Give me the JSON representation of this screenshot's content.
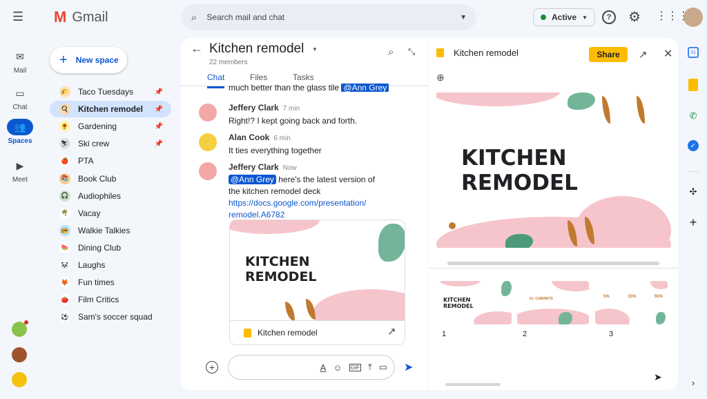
{
  "app": {
    "name": "Gmail",
    "search_placeholder": "Search mail and chat",
    "status": "Active",
    "status_color": "#1e8e3e"
  },
  "rail": [
    {
      "label": "Mail",
      "icon": "mail-icon"
    },
    {
      "label": "Chat",
      "icon": "chat-icon"
    },
    {
      "label": "Spaces",
      "icon": "spaces-icon"
    },
    {
      "label": "Meet",
      "icon": "video-icon"
    }
  ],
  "sidebar": {
    "new_space": "New space",
    "items": [
      {
        "label": "Taco Tuesdays",
        "emoji": "🌮",
        "pinned": true
      },
      {
        "label": "Kitchen remodel",
        "emoji": "🍳",
        "pinned": true,
        "selected": true
      },
      {
        "label": "Gardening",
        "emoji": "🌻",
        "pinned": true
      },
      {
        "label": "Ski crew",
        "emoji": "⛷",
        "pinned": true
      },
      {
        "label": "PTA",
        "emoji": "🍎"
      },
      {
        "label": "Book Club",
        "emoji": "📚"
      },
      {
        "label": "Audiophiles",
        "emoji": "🎧"
      },
      {
        "label": "Vacay",
        "emoji": "🌴"
      },
      {
        "label": "Walkie Talkies",
        "emoji": "📻"
      },
      {
        "label": "Dining Club",
        "emoji": "🍉"
      },
      {
        "label": "Laughs",
        "emoji": "🐼"
      },
      {
        "label": "Fun times",
        "emoji": "🦊"
      },
      {
        "label": "Film Critics",
        "emoji": "🍅"
      },
      {
        "label": "Sam's soccer squad",
        "emoji": "⚽"
      }
    ]
  },
  "chat": {
    "title": "Kitchen remodel",
    "members": "22 members",
    "tabs": [
      "Chat",
      "Files",
      "Tasks"
    ],
    "partial_message": "much better than the glass tile",
    "partial_mention": "@Ann Grey",
    "messages": [
      {
        "author": "Jeffery Clark",
        "time": "7 min",
        "text": "Right!? I kept going back and forth."
      },
      {
        "author": "Alan Cook",
        "time": "6 min",
        "text": "It ties everything together"
      },
      {
        "author": "Jeffery Clark",
        "time": "Now",
        "mention": "@Ann Grey",
        "text": "here's the latest version of",
        "text2": "the kitchen remodel deck",
        "link1": "https://docs.google.com/presentation/",
        "link2": "remodel.A6782"
      }
    ],
    "attachment": {
      "slide_title_1": "KITCHEN",
      "slide_title_2": "REMODEL",
      "name": "Kitchen remodel"
    }
  },
  "preview": {
    "title": "Kitchen remodel",
    "share": "Share",
    "slide_title_1": "KITCHEN",
    "slide_title_2": "REMODEL",
    "thumbs": [
      {
        "num": "1",
        "t1": "KITCHEN",
        "t2": "REMODEL"
      },
      {
        "num": "2",
        "t1": "01. CABINETS"
      },
      {
        "num": "3",
        "stats": [
          "5%",
          "15%",
          "55%"
        ]
      }
    ]
  },
  "colors": {
    "accent": "#0b57d0",
    "share": "#fbbc04",
    "selected": "#d3e3fd"
  }
}
